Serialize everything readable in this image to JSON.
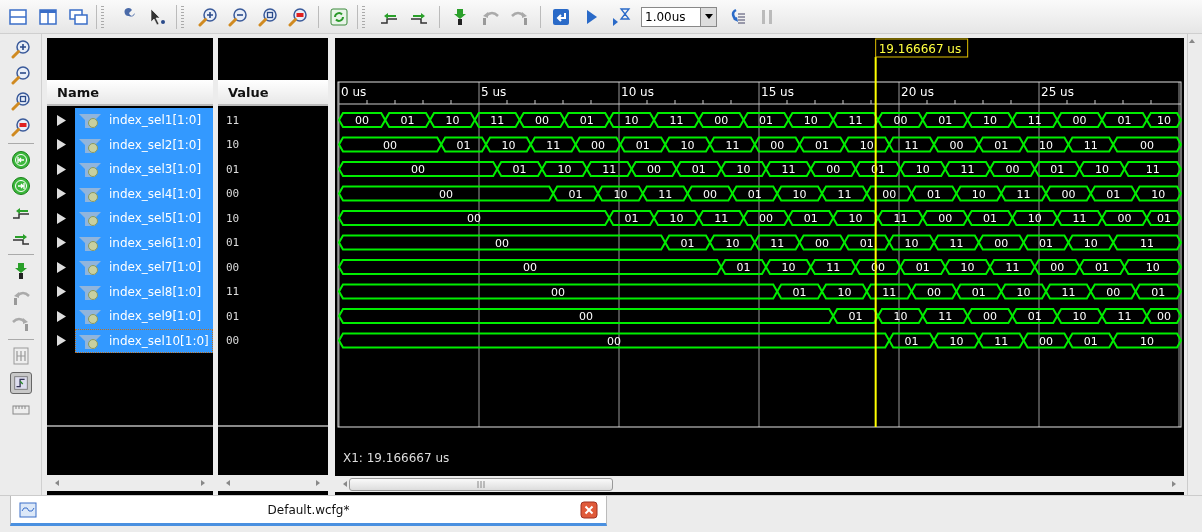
{
  "toolbar": {
    "run_time": "1.00us"
  },
  "toggle_button": {
    "on": true
  },
  "columns": {
    "name": "Name",
    "value": "Value"
  },
  "signals": [
    {
      "name": "index_sel1[1:0]",
      "value": "11",
      "selected": true,
      "focused": false,
      "segments": [
        "00",
        "01",
        "10",
        "11",
        "00",
        "01",
        "10",
        "11",
        "00",
        "01",
        "10",
        "11",
        "00",
        "01",
        "10",
        "11",
        "00",
        "01",
        "10"
      ]
    },
    {
      "name": "index_sel2[1:0]",
      "value": "10",
      "selected": true,
      "focused": false,
      "segments": [
        "00",
        "01",
        "10",
        "11",
        "00",
        "01",
        "10",
        "11",
        "00",
        "01",
        "10",
        "11",
        "00",
        "01",
        "10",
        "11",
        "00"
      ]
    },
    {
      "name": "index_sel3[1:0]",
      "value": "01",
      "selected": true,
      "focused": false,
      "segments": [
        "00",
        "01",
        "10",
        "11",
        "00",
        "01",
        "10",
        "11",
        "00",
        "01",
        "10",
        "11",
        "00",
        "01",
        "10",
        "11"
      ]
    },
    {
      "name": "index_sel4[1:0]",
      "value": "00",
      "selected": true,
      "focused": false,
      "segments": [
        "00",
        "01",
        "10",
        "11",
        "00",
        "01",
        "10",
        "11",
        "00",
        "01",
        "10",
        "11",
        "00",
        "01",
        "10"
      ]
    },
    {
      "name": "index_sel5[1:0]",
      "value": "10",
      "selected": true,
      "focused": false,
      "segments": [
        "00",
        "01",
        "10",
        "11",
        "00",
        "01",
        "10",
        "11",
        "00",
        "01",
        "10",
        "11",
        "00",
        "01"
      ]
    },
    {
      "name": "index_sel6[1:0]",
      "value": "01",
      "selected": true,
      "focused": false,
      "segments": [
        "00",
        "01",
        "10",
        "11",
        "00",
        "01",
        "10",
        "11",
        "00",
        "01",
        "10",
        "11"
      ]
    },
    {
      "name": "index_sel7[1:0]",
      "value": "00",
      "selected": true,
      "focused": false,
      "segments": [
        "00",
        "01",
        "10",
        "11",
        "00",
        "01",
        "10",
        "11",
        "00",
        "01",
        "10"
      ]
    },
    {
      "name": "index_sel8[1:0]",
      "value": "11",
      "selected": true,
      "focused": false,
      "segments": [
        "00",
        "01",
        "10",
        "11",
        "00",
        "01",
        "10",
        "11",
        "00",
        "01"
      ]
    },
    {
      "name": "index_sel9[1:0]",
      "value": "01",
      "selected": true,
      "focused": false,
      "segments": [
        "00",
        "01",
        "10",
        "11",
        "00",
        "01",
        "10",
        "11",
        "00"
      ]
    },
    {
      "name": "index_sel10[1:0]",
      "value": "00",
      "selected": true,
      "focused": true,
      "segments": [
        "00",
        "01",
        "10",
        "11",
        "00",
        "01",
        "10"
      ]
    }
  ],
  "time_ruler": [
    "0 us",
    "5 us",
    "10 us",
    "15 us",
    "20 us",
    "25 us"
  ],
  "marker": {
    "label": "19.166667 us"
  },
  "cursor_readout": "X1: 19.166667 us",
  "tabs": [
    {
      "label": "Default.wcfg*",
      "selected": true
    }
  ]
}
